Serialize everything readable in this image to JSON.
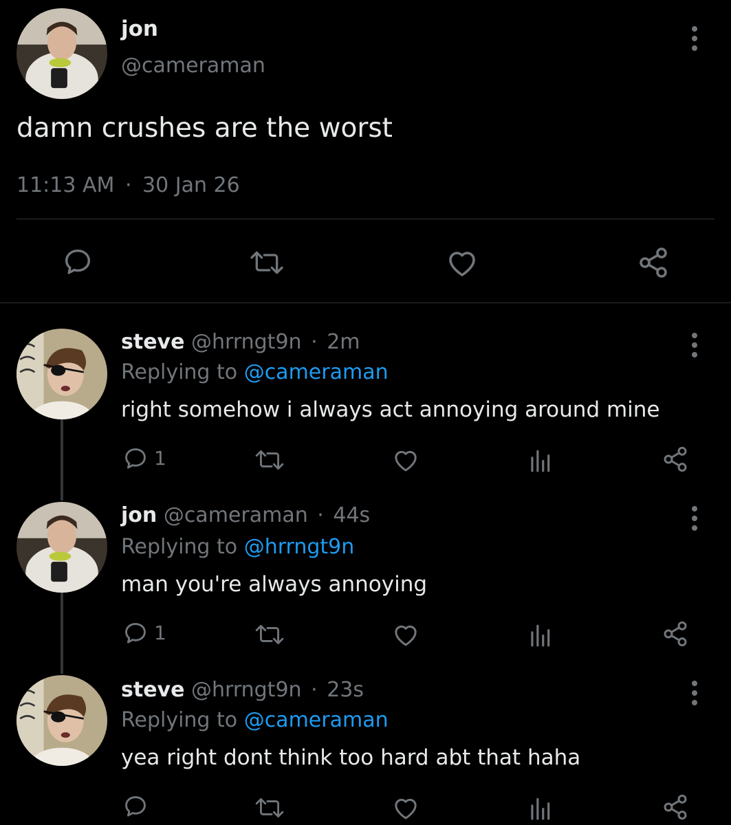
{
  "main_tweet": {
    "display_name": "jon",
    "handle": "@cameraman",
    "text": "damn crushes are the worst",
    "time": "11:13 AM",
    "separator": "·",
    "date": "30 Jan 26",
    "actions": [
      "reply-icon",
      "retweet-icon",
      "like-icon",
      "share-icon"
    ]
  },
  "replies": [
    {
      "display_name": "steve",
      "handle": "@hrrngt9n",
      "dot": "·",
      "time": "2m",
      "replying_prefix": "Replying to",
      "replying_to": "@cameraman",
      "text": "right somehow i always act annoying around mine",
      "reply_count": "1"
    },
    {
      "display_name": "jon",
      "handle": "@cameraman",
      "dot": "·",
      "time": "44s",
      "replying_prefix": "Replying to",
      "replying_to": "@hrrngt9n",
      "text": "man you're always annoying",
      "reply_count": "1"
    },
    {
      "display_name": "steve",
      "handle": "@hrrngt9n",
      "dot": "·",
      "time": "23s",
      "replying_prefix": "Replying to",
      "replying_to": "@cameraman",
      "text": "yea right dont think too hard abt that haha",
      "reply_count": ""
    }
  ],
  "colors": {
    "background": "#000000",
    "text": "#e7e9ea",
    "secondary": "#71767b",
    "link": "#1d9bf0",
    "divider": "#2f3336"
  }
}
